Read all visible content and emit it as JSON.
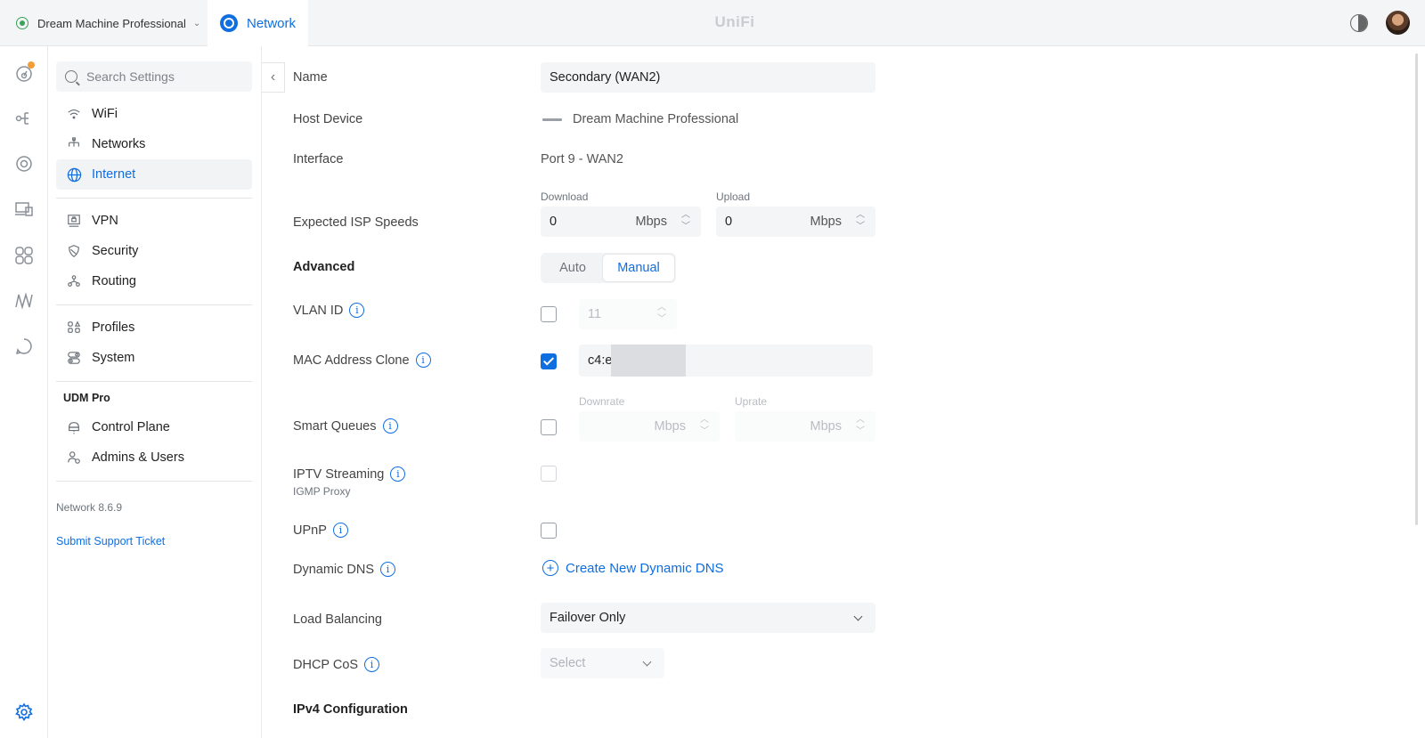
{
  "topbar": {
    "device_name": "Dream Machine Professional",
    "app_tab_label": "Network",
    "brand": "UniFi"
  },
  "nav": {
    "search_placeholder": "Search Settings",
    "items": [
      {
        "label": "WiFi"
      },
      {
        "label": "Networks"
      },
      {
        "label": "Internet",
        "active": true
      },
      {
        "label": "VPN"
      },
      {
        "label": "Security"
      },
      {
        "label": "Routing"
      },
      {
        "label": "Profiles"
      },
      {
        "label": "System"
      }
    ],
    "section_title": "UDM Pro",
    "section_items": [
      {
        "label": "Control Plane"
      },
      {
        "label": "Admins & Users"
      }
    ],
    "version": "Network 8.6.9",
    "support_link": "Submit Support Ticket"
  },
  "form": {
    "name": {
      "label": "Name",
      "value": "Secondary (WAN2)"
    },
    "host_device": {
      "label": "Host Device",
      "value": "Dream Machine Professional"
    },
    "interface": {
      "label": "Interface",
      "value": "Port 9 - WAN2"
    },
    "isp_speeds": {
      "label": "Expected ISP Speeds",
      "download_label": "Download",
      "download_value": "0",
      "upload_label": "Upload",
      "upload_value": "0",
      "unit": "Mbps"
    },
    "advanced": {
      "label": "Advanced",
      "options": [
        "Auto",
        "Manual"
      ],
      "selected": "Manual"
    },
    "vlan_id": {
      "label": "VLAN ID",
      "value": "11",
      "checked": false
    },
    "mac_clone": {
      "label": "MAC Address Clone",
      "value": "c4:e",
      "checked": true
    },
    "smart_queues": {
      "label": "Smart Queues",
      "downrate_label": "Downrate",
      "uprate_label": "Uprate",
      "unit": "Mbps",
      "checked": false
    },
    "iptv": {
      "label": "IPTV Streaming",
      "sublabel": "IGMP Proxy",
      "checked": false
    },
    "upnp": {
      "label": "UPnP",
      "checked": false
    },
    "dynamic_dns": {
      "label": "Dynamic DNS",
      "action": "Create New Dynamic DNS"
    },
    "load_balancing": {
      "label": "Load Balancing",
      "value": "Failover Only"
    },
    "dhcp_cos": {
      "label": "DHCP CoS",
      "placeholder": "Select"
    },
    "ipv4_heading": "IPv4 Configuration"
  },
  "colors": {
    "accent": "#0f6ee0",
    "notify": "#f29d38",
    "status_ok": "#3aa35a"
  }
}
